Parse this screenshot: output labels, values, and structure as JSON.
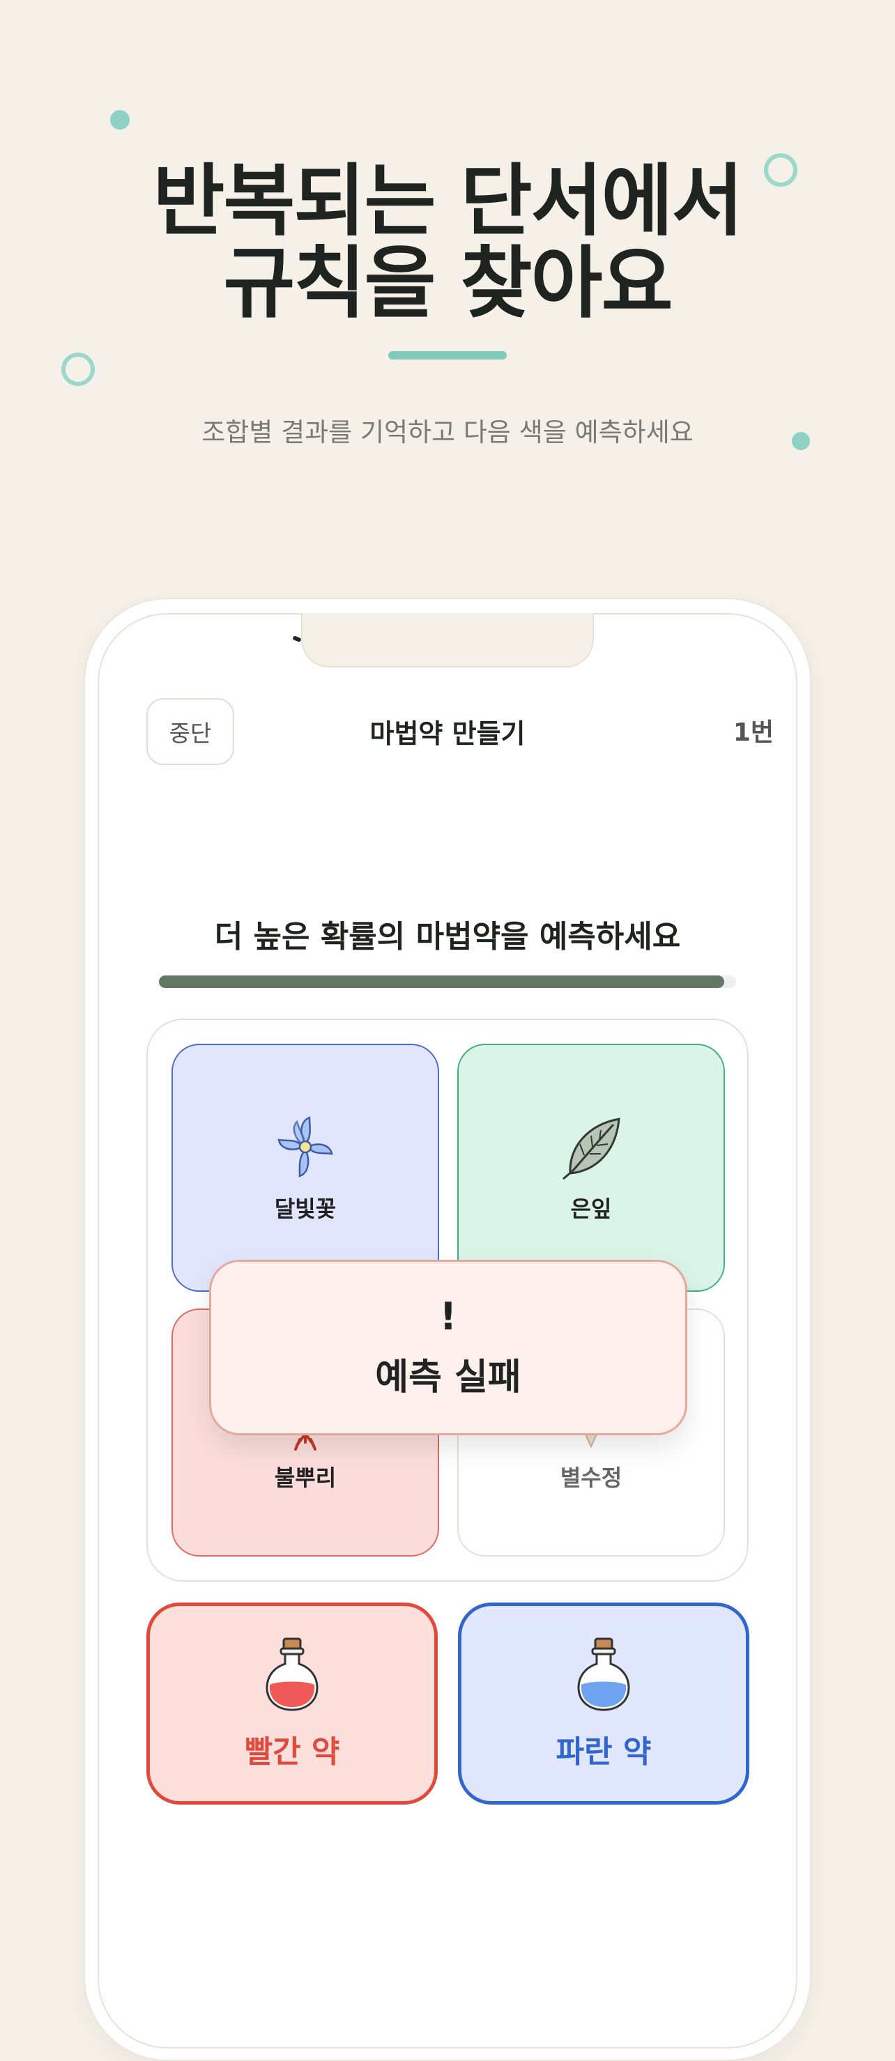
{
  "header": {
    "headline_line1": "반복되는 단서에서",
    "headline_line2": "규칙을 찾아요",
    "subtitle": "조합별 결과를 기억하고 다음 색을 예측하세요"
  },
  "app": {
    "stop_label": "중단",
    "title": "마법약 만들기",
    "counter": "1번",
    "question": "더 높은 확률의 마법약을 예측하세요",
    "progress": 0.98
  },
  "ingredients": [
    {
      "label": "달빛꽃",
      "icon": "moonflower-icon"
    },
    {
      "label": "은잎",
      "icon": "silver-leaf-icon"
    },
    {
      "label": "불뿌리",
      "icon": "fire-root-icon"
    },
    {
      "label": "별수정",
      "icon": "star-crystal-icon"
    }
  ],
  "toast": {
    "icon": "!",
    "text": "예측 실패"
  },
  "choices": {
    "red_label": "빨간 약",
    "blue_label": "파란 약"
  },
  "colors": {
    "background": "#f5f1e8",
    "accent": "#7fcab9",
    "progress": "#637864",
    "red": "#e04a3c",
    "blue": "#3266cf"
  }
}
